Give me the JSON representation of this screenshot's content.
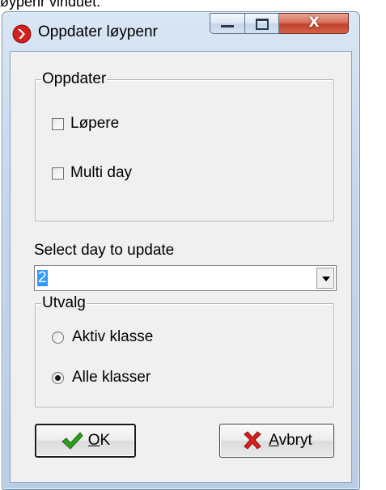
{
  "background_caption": "øypenr vinduet.",
  "window": {
    "title": "Oppdater løypenr",
    "controls": {
      "minimize": "minimize",
      "maximize": "maximize",
      "close": "X"
    }
  },
  "update_group": {
    "label": "Oppdater",
    "options": [
      {
        "label": "Løpere",
        "checked": false
      },
      {
        "label": "Multi day",
        "checked": false
      }
    ]
  },
  "day_select": {
    "label": "Select day to update",
    "value": "2"
  },
  "selection_group": {
    "label": "Utvalg",
    "options": [
      {
        "label": "Aktiv klasse",
        "selected": false
      },
      {
        "label": "Alle klasser",
        "selected": true
      }
    ]
  },
  "buttons": {
    "ok": {
      "label": "OK",
      "icon": "checkmark-icon",
      "color": "#2f9e1f"
    },
    "cancel": {
      "label": "Avbryt",
      "icon": "cross-icon",
      "color": "#d8201a"
    }
  }
}
